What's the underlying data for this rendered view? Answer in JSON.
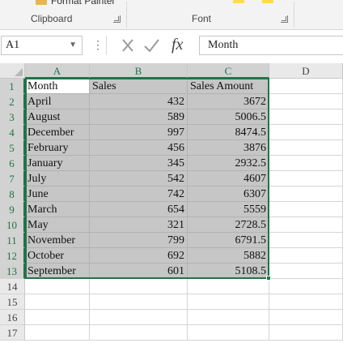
{
  "ribbon": {
    "format_painter_label": "Format Painter",
    "groups": [
      "Clipboard",
      "Font"
    ]
  },
  "formula_bar": {
    "name_box_value": "A1",
    "formula_value": "Month",
    "fx_label": "fx"
  },
  "columns": [
    "A",
    "B",
    "C",
    "D"
  ],
  "rows": [
    "1",
    "2",
    "3",
    "4",
    "5",
    "6",
    "7",
    "8",
    "9",
    "10",
    "11",
    "12",
    "13",
    "14",
    "15",
    "16",
    "17"
  ],
  "table": {
    "headers": [
      "Month",
      "Sales",
      "Sales Amount"
    ],
    "rows": [
      [
        "April",
        "432",
        "3672"
      ],
      [
        "August",
        "589",
        "5006.5"
      ],
      [
        "December",
        "997",
        "8474.5"
      ],
      [
        "February",
        "456",
        "3876"
      ],
      [
        "January",
        "345",
        "2932.5"
      ],
      [
        "July",
        "542",
        "4607"
      ],
      [
        "June",
        "742",
        "6307"
      ],
      [
        "March",
        "654",
        "5559"
      ],
      [
        "May",
        "321",
        "2728.5"
      ],
      [
        "November",
        "799",
        "6791.5"
      ],
      [
        "October",
        "692",
        "5882"
      ],
      [
        "September",
        "601",
        "5108.5"
      ]
    ]
  },
  "colors": {
    "selection_accent": "#217346",
    "selection_fill": "#c6c6c6"
  }
}
